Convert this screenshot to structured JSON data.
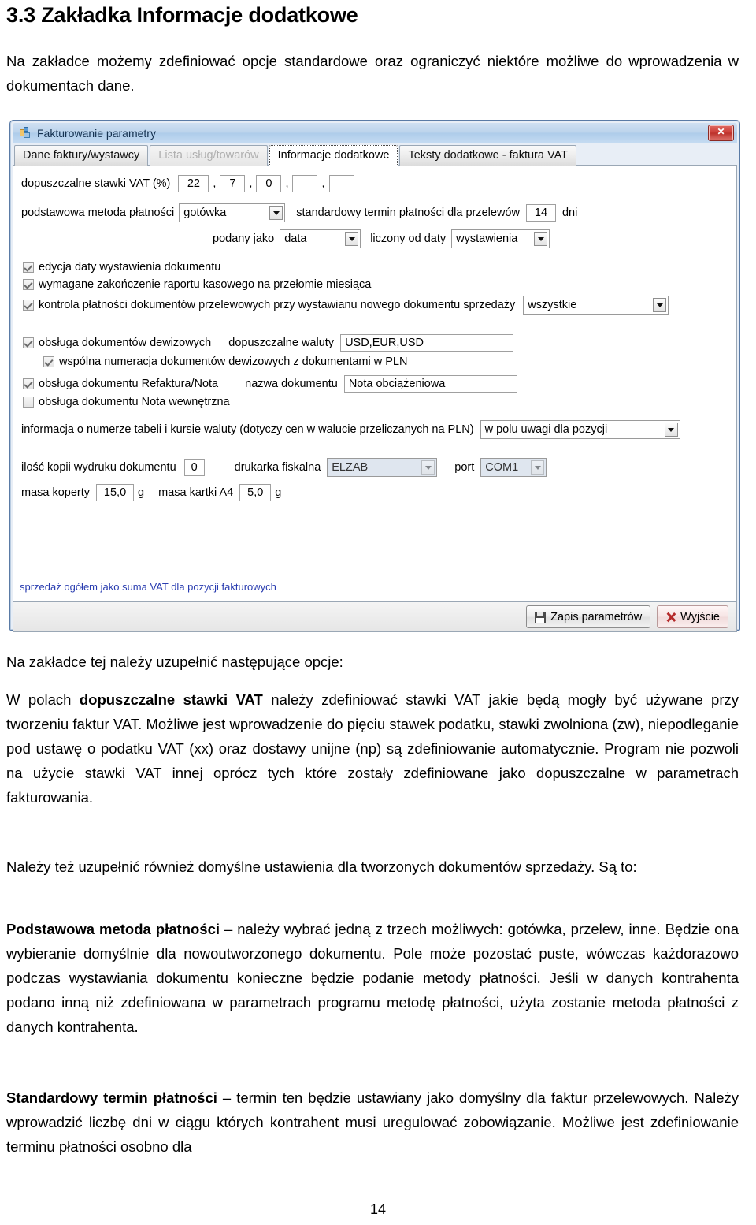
{
  "document": {
    "heading": "3.3 Zakładka Informacje dodatkowe",
    "intro_line1": "Na zakładce możemy  zdefiniować opcje standardowe oraz ograniczyć niektóre możliwe",
    "intro_line2": "do wprowadzenia w dokumentach dane.",
    "page_number": "14",
    "paragraphs": {
      "p1": "Na zakładce tej należy uzupełnić następujące opcje:",
      "p2_pre": "W  polach ",
      "p2_bold": "dopuszczalne stawki VAT",
      "p2_post": " należy zdefiniować stawki VAT jakie będą mogły być używane przy tworzeniu faktur VAT. Możliwe jest wprowadzenie do pięciu stawek podatku, stawki zwolniona (zw), niepodleganie pod ustawę o podatku VAT (xx) oraz dostawy unijne (np) są zdefiniowanie automatycznie. Program nie pozwoli na użycie stawki VAT innej oprócz tych które zostały zdefiniowane jako dopuszczalne w parametrach fakturowania.",
      "p3": "Należy też uzupełnić również domyślne ustawienia dla tworzonych dokumentów sprzedaży. Są to:",
      "p4_bold": "Podstawowa metoda płatności",
      "p4_post": " – należy wybrać jedną z trzech możliwych: gotówka, przelew, inne. Będzie ona wybieranie domyślnie dla nowoutworzonego dokumentu. Pole może pozostać puste, wówczas każdorazowo podczas wystawiania dokumentu konieczne będzie podanie metody płatności. Jeśli w danych kontrahenta podano inną niż zdefiniowana w parametrach programu metodę płatności, użyta zostanie metoda płatności z danych kontrahenta.",
      "p5_bold": "Standardowy termin płatności",
      "p5_post": " – termin ten będzie ustawiany jako domyślny dla faktur przelewowych. Należy wprowadzić liczbę dni w ciągu których kontrahent musi uregulować zobowiązanie.  Możliwe jest zdefiniowanie terminu płatności osobno dla"
    }
  },
  "dialog": {
    "title": "Fakturowanie parametry",
    "close_label": "✕",
    "tabs": [
      {
        "label": "Dane faktury/wystawcy",
        "state": "normal"
      },
      {
        "label": "Lista usług/towarów",
        "state": "disabled"
      },
      {
        "label": "Informacje dodatkowe",
        "state": "active"
      },
      {
        "label": "Teksty dodatkowe - faktura VAT",
        "state": "normal"
      }
    ],
    "form": {
      "vat_rates_label": "dopuszczalne stawki VAT (%)",
      "vat_rates": [
        "22",
        "7",
        "0",
        "",
        ""
      ],
      "vat_separator": ",",
      "payment_method_label": "podstawowa metoda płatności",
      "payment_method_value": "gotówka",
      "payment_term_label": "standardowy termin płatności dla przelewów",
      "payment_term_value": "14",
      "payment_term_unit": "dni",
      "given_as_label": "podany jako",
      "given_as_value": "data",
      "counted_from_label": "liczony od daty",
      "counted_from_value": "wystawienia",
      "cb_edit_date": {
        "label": "edycja daty wystawienia dokumentu",
        "checked": true
      },
      "cb_cash_report": {
        "label": "wymagane zakończenie raportu kasowego na przełomie miesiąca",
        "checked": true
      },
      "cb_payment_control": {
        "label": "kontrola płatności dokumentów przelewowych przy wystawianu nowego dokumentu sprzedaży",
        "checked": true
      },
      "payment_control_value": "wszystkie",
      "cb_currency_docs": {
        "label": "obsługa dokumentów dewizowych",
        "checked": true
      },
      "currencies_label": "dopuszczalne waluty",
      "currencies_value": "USD,EUR,USD",
      "cb_common_numbering": {
        "label": "wspólna numeracja dokumentów dewizowych z dokumentami w PLN",
        "checked": true
      },
      "cb_refaktura": {
        "label": "obsługa dokumentu Refaktura/Nota",
        "checked": true
      },
      "doc_name_label": "nazwa dokumentu",
      "doc_name_value": "Nota obciążeniowa",
      "cb_internal_note": {
        "label": "obsługa dokumentu Nota wewnętrzna",
        "checked": false
      },
      "rate_info_label": "informacja o numerze tabeli i kursie waluty (dotyczy cen w walucie przeliczanych na PLN)",
      "rate_info_value": "w polu uwagi dla pozycji",
      "copies_label": "ilość kopii wydruku dokumentu",
      "copies_value": "0",
      "fiscal_printer_label": "drukarka fiskalna",
      "fiscal_printer_value": "ELZAB",
      "port_label": "port",
      "port_value": "COM1",
      "envelope_mass_label": "masa koperty",
      "envelope_mass_value": "15,0",
      "envelope_mass_unit": "g",
      "sheet_mass_label": "masa kartki A4",
      "sheet_mass_value": "5,0",
      "sheet_mass_unit": "g",
      "status_text": "sprzedaż ogółem jako suma VAT dla pozycji fakturowych"
    },
    "buttons": {
      "save": "Zapis parametrów",
      "exit": "Wyjście"
    }
  }
}
